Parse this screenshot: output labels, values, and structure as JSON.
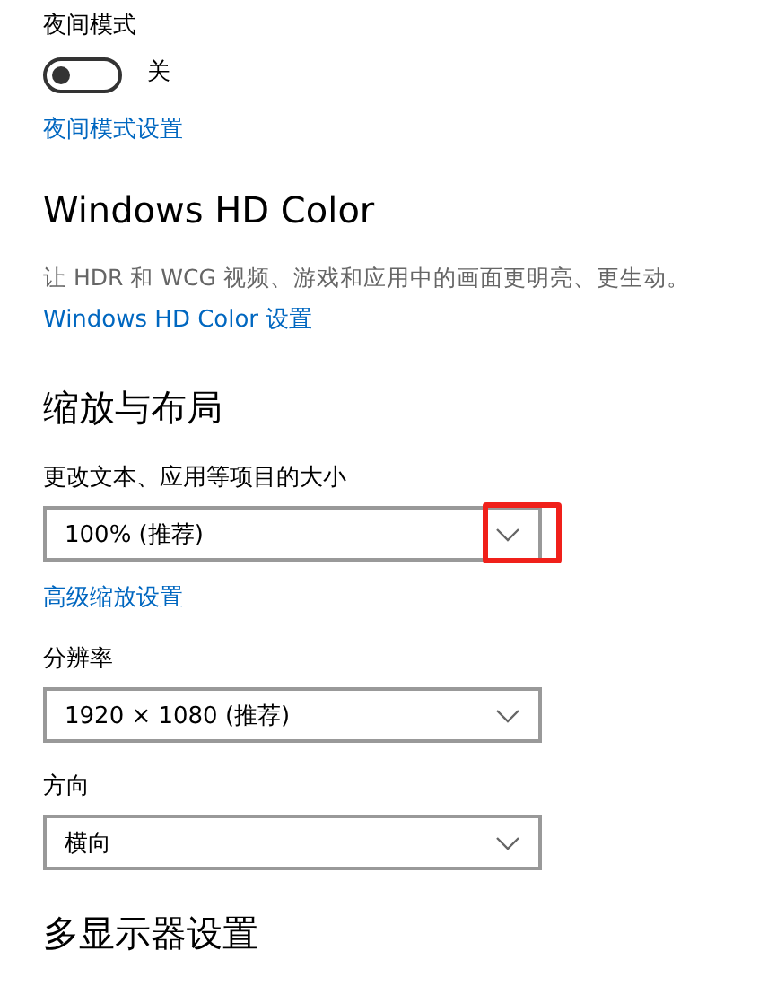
{
  "night_mode": {
    "label": "夜间模式",
    "toggle": {
      "on": false,
      "state_text": "关"
    },
    "link": "夜间模式设置"
  },
  "hd_color": {
    "heading": "Windows HD Color",
    "description": "让 HDR 和 WCG 视频、游戏和应用中的画面更明亮、更生动。",
    "link": "Windows HD Color 设置"
  },
  "scale_layout": {
    "heading": "缩放与布局",
    "fields": [
      {
        "kind": "dropdown",
        "label": "更改文本、应用等项目的大小",
        "value": "100% (推荐)",
        "highlighted": true
      },
      {
        "kind": "link",
        "text": "高级缩放设置"
      },
      {
        "kind": "dropdown",
        "label": "分辨率",
        "value": "1920 × 1080 (推荐)",
        "highlighted": false
      },
      {
        "kind": "dropdown",
        "label": "方向",
        "value": "横向",
        "highlighted": false
      }
    ]
  },
  "multi_display": {
    "heading": "多显示器设置"
  }
}
